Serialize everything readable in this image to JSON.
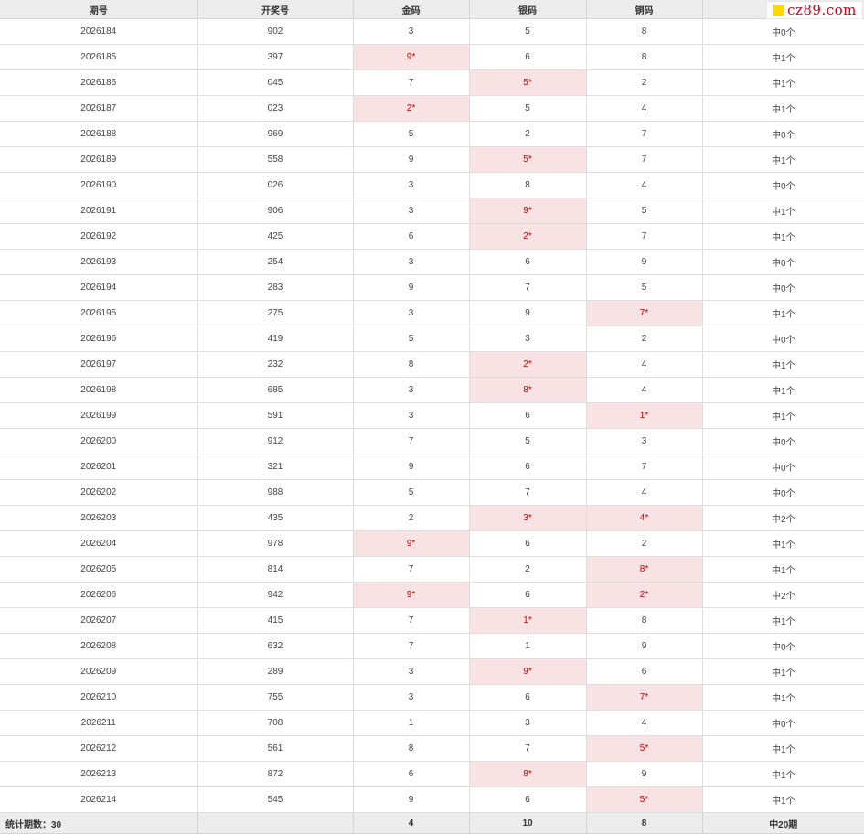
{
  "header": {
    "issue": "期号",
    "draw": "开奖号",
    "gold": "金码",
    "silver": "银码",
    "copper": "铜码",
    "result": ""
  },
  "logo": {
    "text": "cz89.com",
    "square_color": "#ffd800",
    "text_color": "#d4001e"
  },
  "highlight_color": "#f9e2e3",
  "rows": [
    {
      "issue": "2026184",
      "draw": "902",
      "gold": "3",
      "silver": "5",
      "copper": "8",
      "result": "中0个",
      "hits": [
        false,
        false,
        false
      ]
    },
    {
      "issue": "2026185",
      "draw": "397",
      "gold": "9*",
      "silver": "6",
      "copper": "8",
      "result": "中1个",
      "hits": [
        true,
        false,
        false
      ]
    },
    {
      "issue": "2026186",
      "draw": "045",
      "gold": "7",
      "silver": "5*",
      "copper": "2",
      "result": "中1个",
      "hits": [
        false,
        true,
        false
      ]
    },
    {
      "issue": "2026187",
      "draw": "023",
      "gold": "2*",
      "silver": "5",
      "copper": "4",
      "result": "中1个",
      "hits": [
        true,
        false,
        false
      ]
    },
    {
      "issue": "2026188",
      "draw": "969",
      "gold": "5",
      "silver": "2",
      "copper": "7",
      "result": "中0个",
      "hits": [
        false,
        false,
        false
      ]
    },
    {
      "issue": "2026189",
      "draw": "558",
      "gold": "9",
      "silver": "5*",
      "copper": "7",
      "result": "中1个",
      "hits": [
        false,
        true,
        false
      ]
    },
    {
      "issue": "2026190",
      "draw": "026",
      "gold": "3",
      "silver": "8",
      "copper": "4",
      "result": "中0个",
      "hits": [
        false,
        false,
        false
      ]
    },
    {
      "issue": "2026191",
      "draw": "906",
      "gold": "3",
      "silver": "9*",
      "copper": "5",
      "result": "中1个",
      "hits": [
        false,
        true,
        false
      ]
    },
    {
      "issue": "2026192",
      "draw": "425",
      "gold": "6",
      "silver": "2*",
      "copper": "7",
      "result": "中1个",
      "hits": [
        false,
        true,
        false
      ]
    },
    {
      "issue": "2026193",
      "draw": "254",
      "gold": "3",
      "silver": "6",
      "copper": "9",
      "result": "中0个",
      "hits": [
        false,
        false,
        false
      ]
    },
    {
      "issue": "2026194",
      "draw": "283",
      "gold": "9",
      "silver": "7",
      "copper": "5",
      "result": "中0个",
      "hits": [
        false,
        false,
        false
      ]
    },
    {
      "issue": "2026195",
      "draw": "275",
      "gold": "3",
      "silver": "9",
      "copper": "7*",
      "result": "中1个",
      "hits": [
        false,
        false,
        true
      ]
    },
    {
      "issue": "2026196",
      "draw": "419",
      "gold": "5",
      "silver": "3",
      "copper": "2",
      "result": "中0个",
      "hits": [
        false,
        false,
        false
      ]
    },
    {
      "issue": "2026197",
      "draw": "232",
      "gold": "8",
      "silver": "2*",
      "copper": "4",
      "result": "中1个",
      "hits": [
        false,
        true,
        false
      ]
    },
    {
      "issue": "2026198",
      "draw": "685",
      "gold": "3",
      "silver": "8*",
      "copper": "4",
      "result": "中1个",
      "hits": [
        false,
        true,
        false
      ]
    },
    {
      "issue": "2026199",
      "draw": "591",
      "gold": "3",
      "silver": "6",
      "copper": "1*",
      "result": "中1个",
      "hits": [
        false,
        false,
        true
      ]
    },
    {
      "issue": "2026200",
      "draw": "912",
      "gold": "7",
      "silver": "5",
      "copper": "3",
      "result": "中0个",
      "hits": [
        false,
        false,
        false
      ]
    },
    {
      "issue": "2026201",
      "draw": "321",
      "gold": "9",
      "silver": "6",
      "copper": "7",
      "result": "中0个",
      "hits": [
        false,
        false,
        false
      ]
    },
    {
      "issue": "2026202",
      "draw": "988",
      "gold": "5",
      "silver": "7",
      "copper": "4",
      "result": "中0个",
      "hits": [
        false,
        false,
        false
      ]
    },
    {
      "issue": "2026203",
      "draw": "435",
      "gold": "2",
      "silver": "3*",
      "copper": "4*",
      "result": "中2个",
      "hits": [
        false,
        true,
        true
      ]
    },
    {
      "issue": "2026204",
      "draw": "978",
      "gold": "9*",
      "silver": "6",
      "copper": "2",
      "result": "中1个",
      "hits": [
        true,
        false,
        false
      ]
    },
    {
      "issue": "2026205",
      "draw": "814",
      "gold": "7",
      "silver": "2",
      "copper": "8*",
      "result": "中1个",
      "hits": [
        false,
        false,
        true
      ]
    },
    {
      "issue": "2026206",
      "draw": "942",
      "gold": "9*",
      "silver": "6",
      "copper": "2*",
      "result": "中2个",
      "hits": [
        true,
        false,
        true
      ]
    },
    {
      "issue": "2026207",
      "draw": "415",
      "gold": "7",
      "silver": "1*",
      "copper": "8",
      "result": "中1个",
      "hits": [
        false,
        true,
        false
      ]
    },
    {
      "issue": "2026208",
      "draw": "632",
      "gold": "7",
      "silver": "1",
      "copper": "9",
      "result": "中0个",
      "hits": [
        false,
        false,
        false
      ]
    },
    {
      "issue": "2026209",
      "draw": "289",
      "gold": "3",
      "silver": "9*",
      "copper": "6",
      "result": "中1个",
      "hits": [
        false,
        true,
        false
      ]
    },
    {
      "issue": "2026210",
      "draw": "755",
      "gold": "3",
      "silver": "6",
      "copper": "7*",
      "result": "中1个",
      "hits": [
        false,
        false,
        true
      ]
    },
    {
      "issue": "2026211",
      "draw": "708",
      "gold": "1",
      "silver": "3",
      "copper": "4",
      "result": "中0个",
      "hits": [
        false,
        false,
        false
      ]
    },
    {
      "issue": "2026212",
      "draw": "561",
      "gold": "8",
      "silver": "7",
      "copper": "5*",
      "result": "中1个",
      "hits": [
        false,
        false,
        true
      ]
    },
    {
      "issue": "2026213",
      "draw": "872",
      "gold": "6",
      "silver": "8*",
      "copper": "9",
      "result": "中1个",
      "hits": [
        false,
        true,
        false
      ]
    },
    {
      "issue": "2026214",
      "draw": "545",
      "gold": "9",
      "silver": "6",
      "copper": "5*",
      "result": "中1个",
      "hits": [
        false,
        false,
        true
      ]
    }
  ],
  "footer": {
    "stat_label": "统计期数：30",
    "draw": "",
    "gold": "4",
    "silver": "10",
    "copper": "8",
    "result": "中20期"
  }
}
